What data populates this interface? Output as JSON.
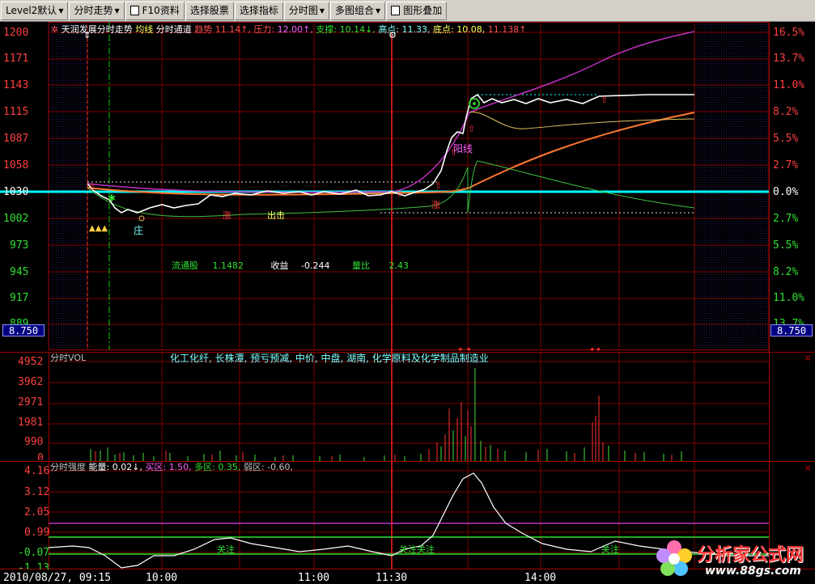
{
  "toolbar": {
    "items": [
      {
        "label": "Level2默认",
        "has_arrow": true
      },
      {
        "label": "分时走势",
        "has_arrow": true
      },
      {
        "label": "F10资料",
        "has_doc": true
      },
      {
        "label": "选择股票"
      },
      {
        "label": "选择指标"
      },
      {
        "label": "分时图",
        "has_arrow": true
      },
      {
        "label": "多图组合",
        "has_arrow": true
      },
      {
        "label": "图形叠加",
        "has_doc": true
      }
    ]
  },
  "main": {
    "header": {
      "title": "天润发展分时走势",
      "avg_line": "均线",
      "channel": "分时通道",
      "trend_label": "趋势",
      "trend_value": "11.14↑,",
      "pressure_label": "压力:",
      "pressure_value": "12.00↑,",
      "support_label": "支撑:",
      "support_value": "10.14↓,",
      "high_label": "高点:",
      "high_value": "11.33,",
      "low_label": "底点:",
      "low_value": "10.08,",
      "extra_value": "11.138↑"
    },
    "left_axis": [
      "1200",
      "1171",
      "1143",
      "1115",
      "1087",
      "1058",
      "1030",
      "1002",
      "973",
      "945",
      "917",
      "889"
    ],
    "right_axis": [
      "16.5%",
      "13.7%",
      "11.0%",
      "8.2%",
      "5.5%",
      "2.7%",
      "0.0%",
      "2.7%",
      "5.5%",
      "8.2%",
      "11.0%",
      "13.7%"
    ],
    "left_badge": "8.750",
    "right_badge": "8.750",
    "stats": {
      "float_label": "流通股",
      "float_value": "1.1482",
      "eps_label": "收益",
      "eps_value": "-0.244",
      "vol_ratio_label": "量比",
      "vol_ratio_value": "2.43"
    },
    "annotations": {
      "zhuang": "庄",
      "zhang": "涨",
      "chuji": "出击",
      "yanghua": "阳线",
      "zhang2": "涨"
    }
  },
  "volume": {
    "title": "分时VOL",
    "sector": "化工化纤, 长株潭, 预亏预减, 中价, 中盘, 湖南, 化学原料及化学制品制造业",
    "axis": [
      "4952",
      "3962",
      "2971",
      "1981",
      "990",
      "0"
    ]
  },
  "strength": {
    "title": "分时强度",
    "energy_label": "能量:",
    "energy_value": "0.02↓,",
    "buy_label": "买区:",
    "buy_value": "1.50,",
    "multi_label": "多区:",
    "multi_value": "0.35,",
    "weak_label": "弱区:",
    "weak_value": "-0.60,",
    "axis": [
      "4.16",
      "3.12",
      "2.05",
      "0.99",
      "-0.07",
      "-1.13"
    ],
    "attention": "关注"
  },
  "time_axis": {
    "date": "2010/08/27, 09:15",
    "labels": [
      "10:00",
      "11:00",
      "11:30",
      "14:00"
    ]
  },
  "logo": {
    "name": "分析家公式网",
    "url": "www.88gs.com"
  },
  "colors": {
    "grid": "#800000",
    "price_up": "#ff3232",
    "price_down": "#00ff00",
    "zero_line": "#00ffff",
    "price_line": "#ffffff"
  }
}
